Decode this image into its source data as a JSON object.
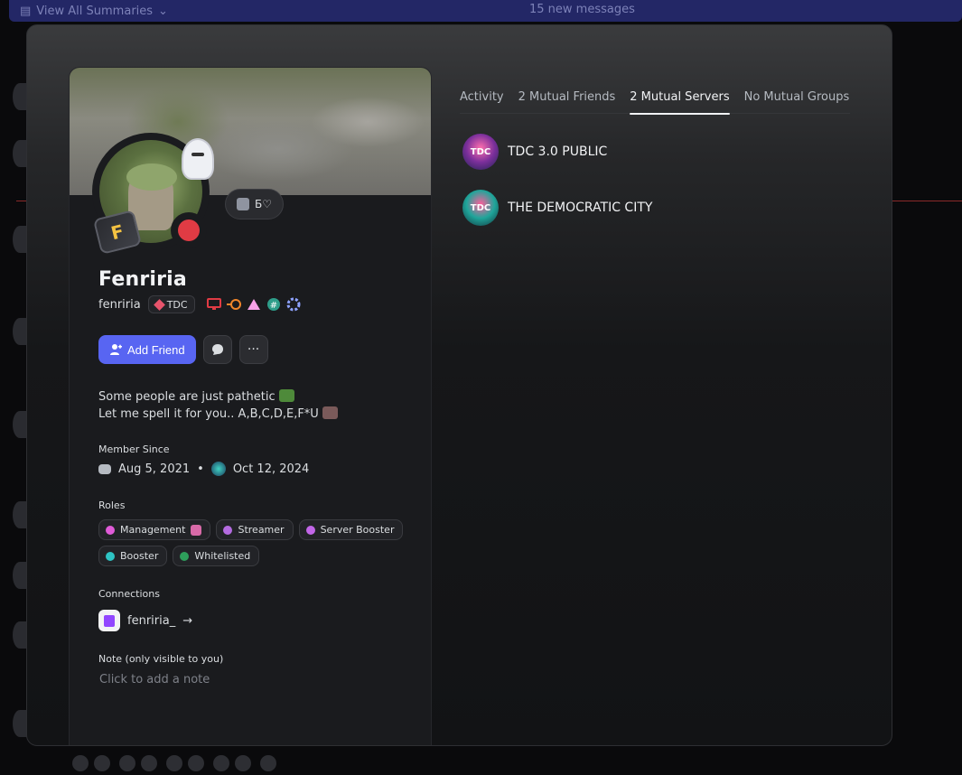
{
  "topbar": {
    "summaries_label": "View All Summaries",
    "new_messages": "15 new messages"
  },
  "profile": {
    "display_name": "Fenriria",
    "username": "fenriria",
    "server_tag": "TDC",
    "status_badge_text": "Б♡",
    "avatar_badge_letter": "F",
    "status_color": "#e03b44",
    "badges": [
      "monitor-icon",
      "nitro-icon",
      "triangle-icon",
      "hash-icon",
      "boost-gear-icon"
    ],
    "actions": {
      "add_friend_label": "Add Friend"
    },
    "bio": {
      "line1": "Some people are just pathetic",
      "line2": "Let me spell it for you.. A,B,C,D,E,F*U"
    },
    "member_since": {
      "label": "Member Since",
      "discord_date": "Aug 5, 2021",
      "separator": "•",
      "server_date": "Oct 12, 2024"
    },
    "roles": {
      "label": "Roles",
      "items": [
        {
          "name": "Management",
          "color": "#e05bd8"
        },
        {
          "name": "Streamer",
          "color": "#b46be0"
        },
        {
          "name": "Server Booster",
          "color": "#c266e8"
        },
        {
          "name": "Booster",
          "color": "#2ec4c4"
        },
        {
          "name": "Whitelisted",
          "color": "#2e9e5b"
        }
      ]
    },
    "connections": {
      "label": "Connections",
      "items": [
        {
          "service": "twitch",
          "name": "fenriria_",
          "arrow": "→"
        }
      ]
    },
    "note": {
      "label": "Note (only visible to you)",
      "placeholder": "Click to add a note"
    }
  },
  "tabs": [
    {
      "label": "Activity",
      "active": false
    },
    {
      "label": "2 Mutual Friends",
      "active": false
    },
    {
      "label": "2 Mutual Servers",
      "active": true
    },
    {
      "label": "No Mutual Groups",
      "active": false
    }
  ],
  "mutual_servers": [
    {
      "name": "TDC 3.0 PUBLIC",
      "icon_text": "TDC"
    },
    {
      "name": "THE DEMOCRATIC CITY",
      "icon_text": "TDC"
    }
  ],
  "colors": {
    "accent": "#5865f2",
    "modal_bg": "#161719",
    "card_bg": "#1a1b1e"
  }
}
